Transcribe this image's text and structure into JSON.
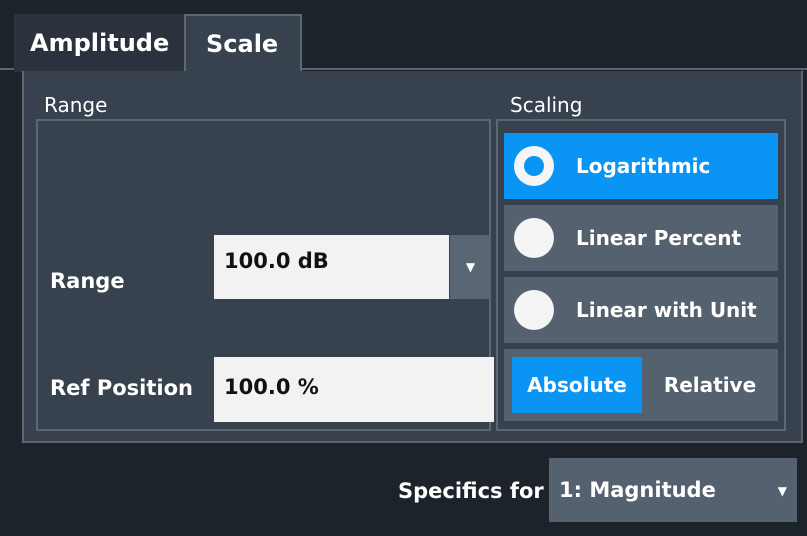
{
  "tabs": [
    {
      "label": "Amplitude",
      "active": false
    },
    {
      "label": "Scale",
      "active": true
    }
  ],
  "range_group": {
    "title": "Range",
    "range_label": "Range",
    "range_value": "100.0 dB",
    "ref_position_label": "Ref Position",
    "ref_position_value": "100.0 %"
  },
  "scaling_group": {
    "title": "Scaling",
    "options": [
      {
        "label": "Logarithmic",
        "selected": true
      },
      {
        "label": "Linear Percent",
        "selected": false
      },
      {
        "label": "Linear with Unit",
        "selected": false
      }
    ],
    "mode_toggle": {
      "absolute_label": "Absolute",
      "relative_label": "Relative",
      "selected": "Absolute"
    }
  },
  "specifics": {
    "label": "Specifics for",
    "value": "1: Magnitude"
  },
  "icons": {
    "dropdown": "chevron-down-icon",
    "radio": "radio-icon"
  },
  "colors": {
    "background": "#1c232b",
    "panel": "#37424e",
    "accent": "#0a95f5",
    "control": "#55616e",
    "field": "#f2f2f2"
  }
}
